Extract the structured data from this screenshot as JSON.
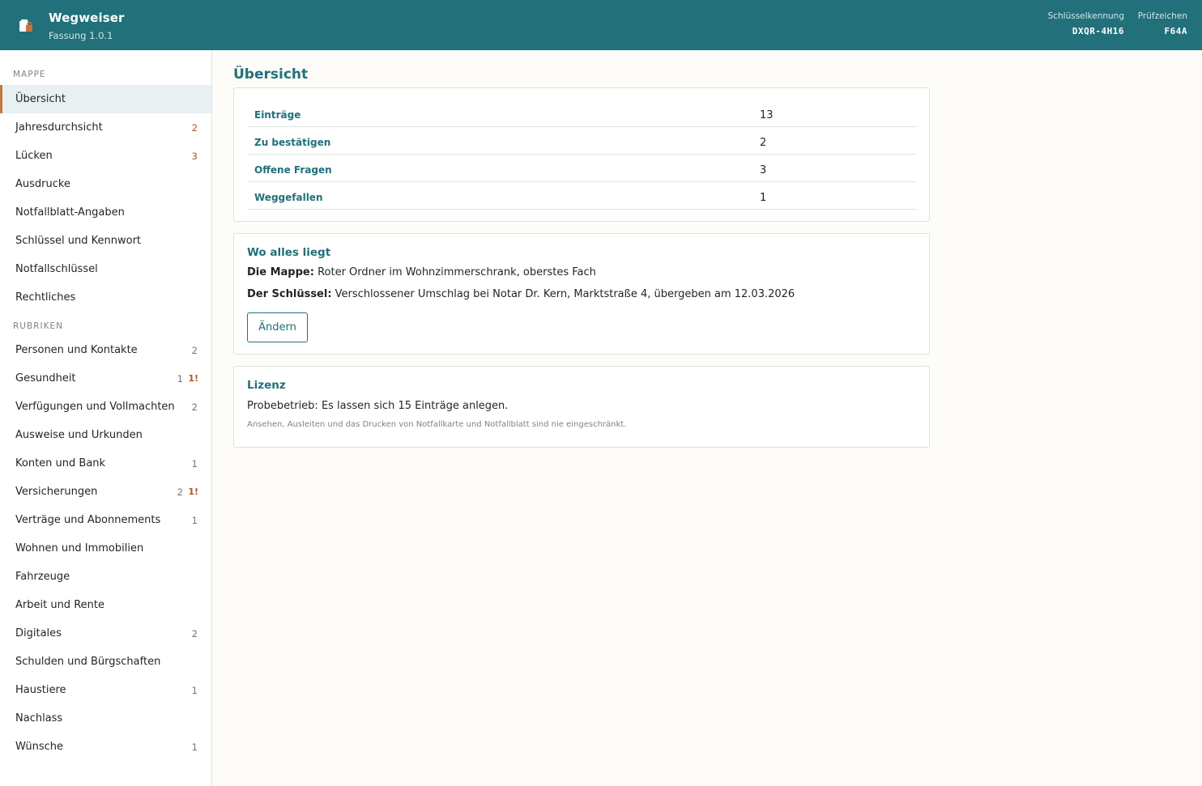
{
  "header": {
    "title": "Wegweiser",
    "version": "Fassung 1.0.1",
    "key_label": "Schlüsselkennung",
    "key_value": "DXQR-4H16",
    "check_label": "Prüfzeichen",
    "check_value": "F64A",
    "logo_icon": "folder-lock-icon"
  },
  "colors": {
    "header_bg": "#21707a",
    "accent": "#c8743f",
    "warning": "#b5521f",
    "text_accent": "#21707a"
  },
  "sidebar": {
    "section_mappe": "MAPPE",
    "section_rubriken": "RUBRIKEN",
    "mappe": [
      {
        "label": "Übersicht",
        "active": true
      },
      {
        "label": "Jahresdurchsicht",
        "count": "2",
        "warn": true
      },
      {
        "label": "Lücken",
        "count": "3",
        "warn": true
      },
      {
        "label": "Ausdrucke"
      },
      {
        "label": "Notfallblatt-Angaben"
      },
      {
        "label": "Schlüssel und Kennwort"
      },
      {
        "label": "Notfallschlüssel"
      },
      {
        "label": "Rechtliches"
      }
    ],
    "rubriken": [
      {
        "label": "Personen und Kontakte",
        "count": "2"
      },
      {
        "label": "Gesundheit",
        "count": "1",
        "flag": "1!"
      },
      {
        "label": "Verfügungen und Vollmachten",
        "count": "2"
      },
      {
        "label": "Ausweise und Urkunden"
      },
      {
        "label": "Konten und Bank",
        "count": "1"
      },
      {
        "label": "Versicherungen",
        "count": "2",
        "flag": "1!"
      },
      {
        "label": "Verträge und Abonnements",
        "count": "1"
      },
      {
        "label": "Wohnen und Immobilien"
      },
      {
        "label": "Fahrzeuge"
      },
      {
        "label": "Arbeit und Rente"
      },
      {
        "label": "Digitales",
        "count": "2"
      },
      {
        "label": "Schulden und Bürgschaften"
      },
      {
        "label": "Haustiere",
        "count": "1"
      },
      {
        "label": "Nachlass"
      },
      {
        "label": "Wünsche",
        "count": "1"
      }
    ]
  },
  "main": {
    "title": "Übersicht",
    "stats": [
      {
        "label": "Einträge",
        "value": "13"
      },
      {
        "label": "Zu bestätigen",
        "value": "2"
      },
      {
        "label": "Offene Fragen",
        "value": "3"
      },
      {
        "label": "Weggefallen",
        "value": "1"
      }
    ],
    "where": {
      "title": "Wo alles liegt",
      "mappe_label": "Die Mappe:",
      "mappe_text": "Roter Ordner im Wohnzimmerschrank, oberstes Fach",
      "key_label": "Der Schlüssel:",
      "key_text": "Verschlossener Umschlag bei Notar Dr. Kern, Marktstraße 4, übergeben am 12.03.2026",
      "edit_button": "Ändern"
    },
    "license": {
      "title": "Lizenz",
      "text": "Probebetrieb: Es lassen sich 15 Einträge anlegen.",
      "note": "Ansehen, Ausleiten und das Drucken von Notfallkarte und Notfallblatt sind nie eingeschränkt."
    }
  }
}
